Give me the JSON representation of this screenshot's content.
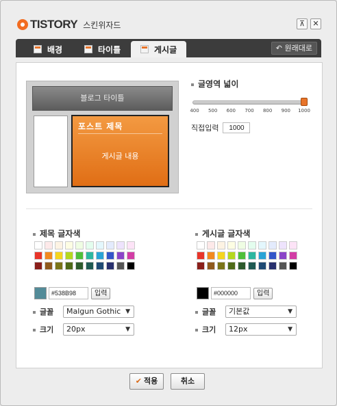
{
  "header": {
    "logo_text": "TISTORY",
    "title": "스킨위자드",
    "pin_icon": "pin-icon",
    "close_icon": "close-icon"
  },
  "tabs": [
    {
      "label": "배경",
      "icon": "background-icon"
    },
    {
      "label": "타이틀",
      "icon": "title-icon"
    },
    {
      "label": "게시글",
      "icon": "post-icon",
      "active": true
    }
  ],
  "restore_label": "원래대로",
  "preview": {
    "blog_title": "블로그 타이틀",
    "post_title": "포스트 제목",
    "post_body": "게시글 내용"
  },
  "width_setting": {
    "label": "글영역 넓이",
    "ticks": [
      "400",
      "500",
      "600",
      "700",
      "800",
      "900",
      "1000"
    ],
    "value": 1000,
    "min": 400,
    "max": 1000,
    "direct_label": "직접입력",
    "direct_value": "1000"
  },
  "title_color": {
    "label": "제목 글자색",
    "hex": "#538B98",
    "hex_display": "#538B98",
    "apply_label": "입력",
    "font_label": "글꼴",
    "font_value": "Malgun Gothic",
    "size_label": "크기",
    "size_value": "20px"
  },
  "post_color": {
    "label": "게시글 글자색",
    "hex": "#000000",
    "hex_display": "#000000",
    "apply_label": "입력",
    "font_label": "글꼴",
    "font_value": "기본값",
    "size_label": "크기",
    "size_value": "12px"
  },
  "palette": [
    "#ffffff",
    "#fde9e9",
    "#fdf3e3",
    "#fdfde3",
    "#effde3",
    "#e3fdee",
    "#e3f7fd",
    "#e3ebfd",
    "#eee3fd",
    "#fde3f7",
    "#e8352a",
    "#f28a1f",
    "#f5d51f",
    "#b5d81f",
    "#4fbf3a",
    "#2db7a0",
    "#29a3d6",
    "#3356c9",
    "#8b45c8",
    "#d23da5",
    "#8a1f1a",
    "#8f5a1d",
    "#7a7418",
    "#4e6a18",
    "#2d5a2c",
    "#1f5a52",
    "#1f4a74",
    "#28306e",
    "#555555",
    "#000000"
  ],
  "footer": {
    "apply_label": "적용",
    "cancel_label": "취소"
  }
}
